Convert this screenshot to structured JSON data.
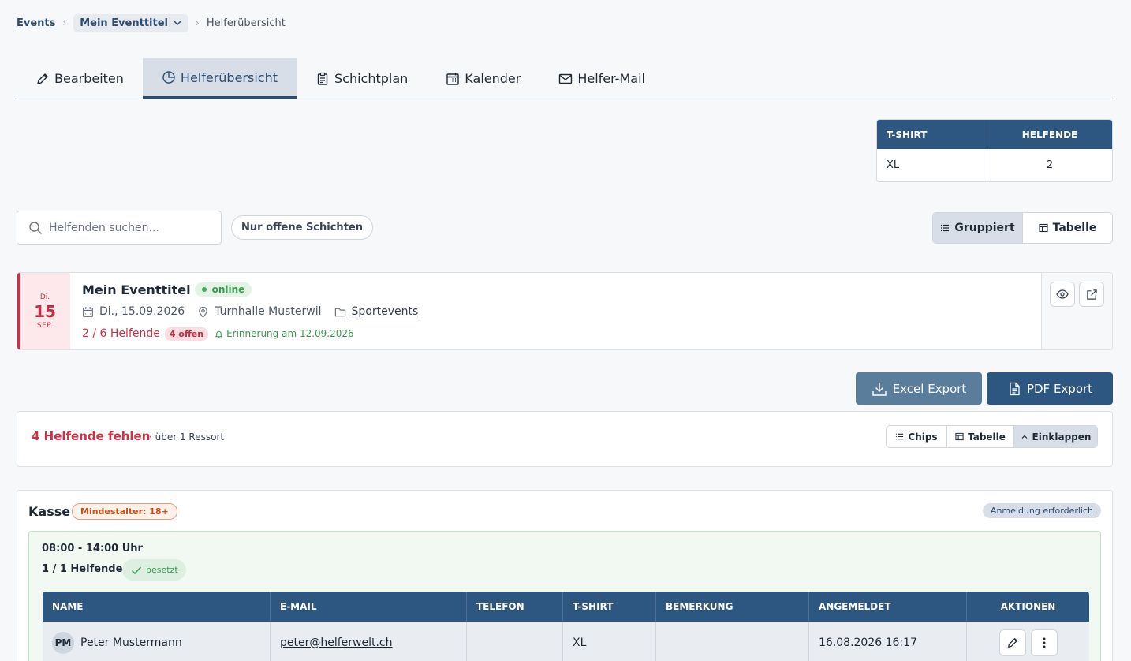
{
  "breadcrumb": {
    "root": "Events",
    "event": "Mein Eventtitel",
    "current": "Helferübersicht"
  },
  "tabs": [
    {
      "label": "Bearbeiten",
      "icon": "pencil-icon"
    },
    {
      "label": "Helferübersicht",
      "icon": "pie-chart-icon",
      "active": true
    },
    {
      "label": "Schichtplan",
      "icon": "clipboard-icon"
    },
    {
      "label": "Kalender",
      "icon": "calendar-icon"
    },
    {
      "label": "Helfer-Mail",
      "icon": "mail-icon"
    }
  ],
  "shirt_table": {
    "headers": [
      "T-SHIRT",
      "HELFENDE"
    ],
    "rows": [
      [
        "XL",
        "2"
      ]
    ]
  },
  "search": {
    "placeholder": "Helfenden suchen..."
  },
  "filter": {
    "open_shifts_label": "Nur offene Schichten"
  },
  "view_toggle": {
    "grouped": "Gruppiert",
    "table": "Tabelle"
  },
  "event": {
    "date_dow": "Di.",
    "date_day": "15",
    "date_month": "SEP.",
    "title": "Mein Eventtitel",
    "status": "online",
    "date_text": "Di., 15.09.2026",
    "location": "Turnhalle Musterwil",
    "category": "Sportevents",
    "helper_count": "2 / 6 Helfende",
    "open_badge": "4 offen",
    "reminder": "Erinnerung am 12.09.2026"
  },
  "exports": {
    "excel": "Excel Export",
    "pdf": "PDF Export"
  },
  "missing": {
    "title": "4 Helfende fehlen",
    "subtitle": "· über 1 Ressort",
    "chips": "Chips",
    "table": "Tabelle",
    "collapse": "Einklappen"
  },
  "ressort": {
    "name": "Kasse",
    "age_badge": "Mindestalter: 18+",
    "registration_badge": "Anmeldung erforderlich",
    "shift": {
      "time": "08:00 - 14:00 Uhr",
      "count": "1 / 1 Helfende",
      "status": "besetzt"
    },
    "table": {
      "headers": [
        "NAME",
        "E-MAIL",
        "TELEFON",
        "T-SHIRT",
        "BEMERKUNG",
        "ANGEMELDET",
        "AKTIONEN"
      ],
      "rows": [
        {
          "initials": "PM",
          "name": "Peter Mustermann",
          "email": "peter@helferwelt.ch",
          "phone": "",
          "shirt": "XL",
          "note": "",
          "registered": "16.08.2026 16:17"
        }
      ]
    }
  },
  "colors": {
    "primary": "#2d5680",
    "danger": "#d12f45",
    "success": "#3a9a4f"
  }
}
